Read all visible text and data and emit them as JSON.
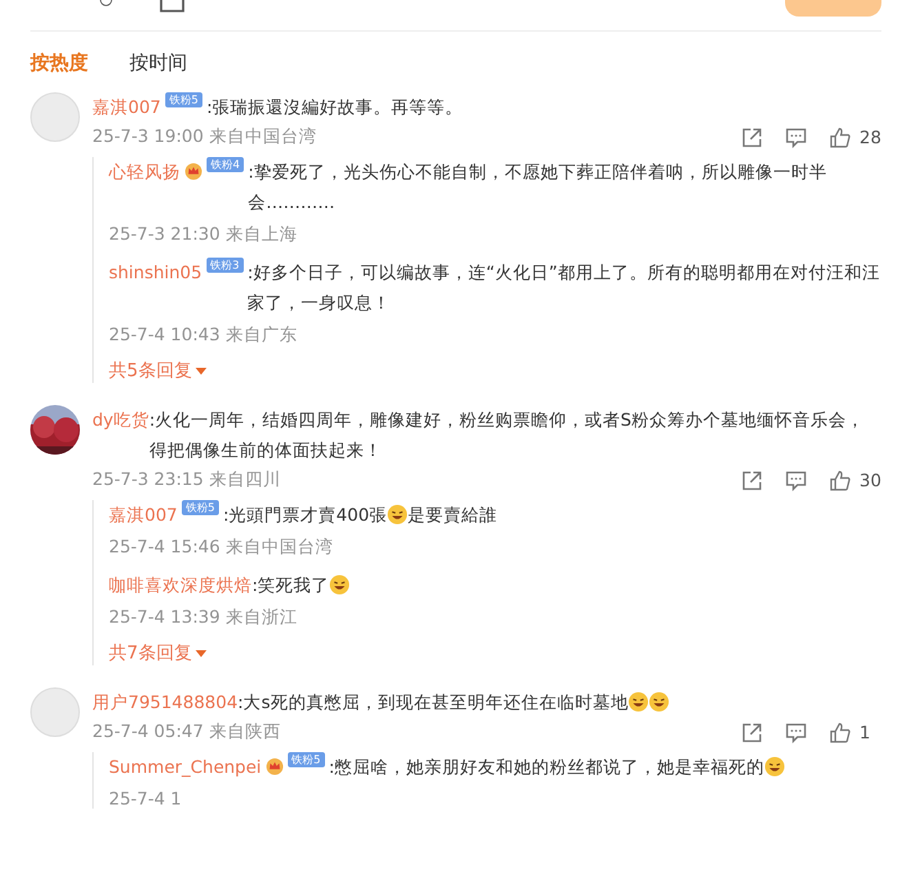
{
  "sort_tabs": [
    {
      "label": "按热度",
      "selected": true
    },
    {
      "label": "按时间",
      "selected": false
    }
  ],
  "comments": [
    {
      "user": "嘉淇007",
      "badge": "铁粉5",
      "crown": false,
      "segments": [
        {
          "kind": "text",
          "text": ":張瑞振還沒編好故事。再等等。"
        }
      ],
      "meta": "25-7-3 19:00 来自中国台湾",
      "likes": "28",
      "replies": [
        {
          "user": "心轻风扬",
          "badge": "铁粉4",
          "crown": true,
          "segments": [
            {
              "kind": "text",
              "text": ":挚爱死了，光头伤心不能自制，不愿她下葬正陪伴着呐，所以雕像一时半会…………"
            }
          ],
          "meta": "25-7-3 21:30 来自上海"
        },
        {
          "user": "shinshin05",
          "badge": "铁粉3",
          "crown": false,
          "segments": [
            {
              "kind": "text",
              "text": ":好多个日子，可以编故事，连“火化日”都用上了。所有的聪明都用在对付汪和汪家了，一身叹息！"
            }
          ],
          "meta": "25-7-4 10:43 来自广东"
        }
      ],
      "more": "共5条回复"
    },
    {
      "avatar": {
        "kind": "picture"
      },
      "user": "dy吃货",
      "segments": [
        {
          "kind": "text",
          "text": ":火化一周年，结婚四周年，雕像建好，粉丝购票瞻仰，或者S粉众筹办个墓地缅怀音乐会，得把偶像生前的体面扶起来！"
        }
      ],
      "meta": "25-7-3 23:15 来自四川",
      "likes": "30",
      "replies": [
        {
          "user": "嘉淇007",
          "badge": "铁粉5",
          "crown": false,
          "segments": [
            {
              "kind": "text",
              "text": ":光頭門票才賣400張"
            },
            {
              "kind": "emoji"
            },
            {
              "kind": "text",
              "text": "是要賣給誰"
            }
          ],
          "meta": "25-7-4 15:46 来自中国台湾"
        },
        {
          "user": "咖啡喜欢深度烘焙",
          "segments": [
            {
              "kind": "text",
              "text": ":笑死我了"
            },
            {
              "kind": "emoji"
            }
          ],
          "meta": "25-7-4 13:39 来自浙江"
        }
      ],
      "more": "共7条回复"
    },
    {
      "user": "用户7951488804",
      "segments": [
        {
          "kind": "text",
          "text": ":大s死的真憋屈，到现在甚至明年还住在临时墓地"
        },
        {
          "kind": "emoji"
        },
        {
          "kind": "emoji"
        }
      ],
      "meta": "25-7-4 05:47 来自陕西",
      "likes": "1",
      "replies": [
        {
          "user": "Summer_Chenpei",
          "badge": "铁粉5",
          "crown": true,
          "segments": [
            {
              "kind": "text",
              "text": ":憋屈啥，她亲朋好友和她的粉丝都说了，她是幸福死的"
            },
            {
              "kind": "emoji"
            }
          ],
          "meta": "25-7-4 1"
        }
      ]
    }
  ]
}
